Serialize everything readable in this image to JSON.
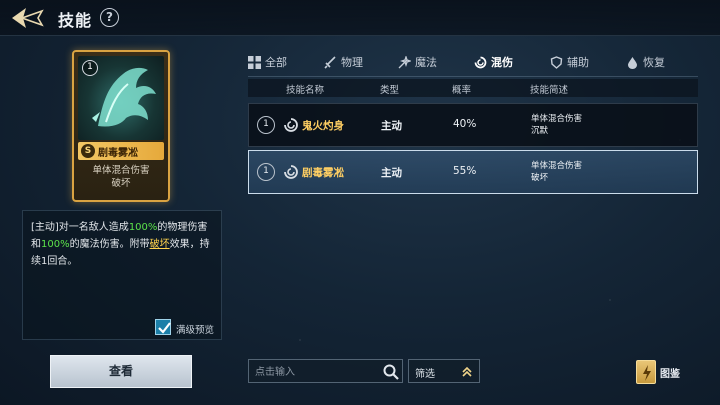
{
  "header": {
    "title": "技能",
    "help_label": "?"
  },
  "card": {
    "level": "1",
    "grade": "S",
    "name": "剧毒雾凇",
    "desc": "单体混合伤害\n破坏",
    "colors": {
      "border": "#d9a342",
      "namebar": "#f2c764"
    }
  },
  "description": {
    "segments": [
      {
        "text": "[主动]对一名敌人造成",
        "style": "normal"
      },
      {
        "text": "100%",
        "style": "green"
      },
      {
        "text": "的物理伤害和",
        "style": "normal"
      },
      {
        "text": "100%",
        "style": "green"
      },
      {
        "text": "的魔法伤害。附带",
        "style": "normal"
      },
      {
        "text": "破坏",
        "style": "yellow"
      },
      {
        "text": "效果，持续1回合。",
        "style": "normal"
      }
    ],
    "full_level_preview_label": "满级预览",
    "full_level_preview_checked": true
  },
  "view_button_label": "查看",
  "tabs": [
    {
      "label": "全部",
      "icon": "grid-icon",
      "active": false
    },
    {
      "label": "物理",
      "icon": "sword-icon",
      "active": false
    },
    {
      "label": "魔法",
      "icon": "magic-icon",
      "active": false
    },
    {
      "label": "混伤",
      "icon": "swirl-icon",
      "active": true
    },
    {
      "label": "辅助",
      "icon": "shield-icon",
      "active": false
    },
    {
      "label": "恢复",
      "icon": "drop-icon",
      "active": false
    }
  ],
  "table": {
    "headers": [
      "技能名称",
      "类型",
      "概率",
      "技能简述"
    ],
    "rows": [
      {
        "level": "1",
        "name": "鬼火灼身",
        "type": "主动",
        "prob": "40%",
        "brief": "单体混合伤害\n沉默",
        "selected": false
      },
      {
        "level": "1",
        "name": "剧毒雾凇",
        "type": "主动",
        "prob": "55%",
        "brief": "单体混合伤害\n破坏",
        "selected": true
      }
    ]
  },
  "search": {
    "placeholder": "点击输入",
    "value": ""
  },
  "filter": {
    "label": "筛选"
  },
  "codex": {
    "label": "图鉴"
  },
  "colors": {
    "accent_gold": "#ffcf63",
    "highlight_green": "#5ce34a",
    "highlight_yellow": "#ffd34d"
  }
}
